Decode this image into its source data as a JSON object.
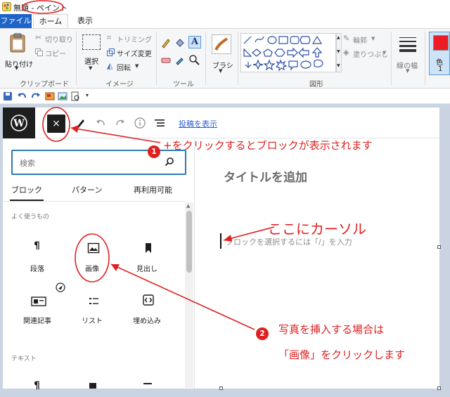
{
  "paint": {
    "title": "無題 - ペイント",
    "tabs": [
      "ファイル",
      "ホーム",
      "表示"
    ],
    "clipboard": {
      "paste": "貼り付け",
      "cut": "切り取り",
      "copy": "コピー",
      "label": "クリップボード"
    },
    "image": {
      "select": "選択",
      "crop": "トリミング",
      "resize": "サイズ変更",
      "rotate": "回転",
      "label": "イメージ"
    },
    "tools": {
      "label": "ツール"
    },
    "brushes": {
      "label": "ブラシ"
    },
    "shapes": {
      "outline": "輪郭",
      "fill": "塗りつぶし",
      "label": "図形"
    },
    "size": {
      "label": "線の幅"
    },
    "color": {
      "label": "色",
      "index": "1",
      "swatch": "#ed1c24"
    }
  },
  "wp": {
    "close_glyph": "×",
    "preview_link": "投稿を表示",
    "search_placeholder": "検索",
    "tabs": [
      "ブロック",
      "パターン",
      "再利用可能"
    ],
    "section_common": "よく使うもの",
    "section_text": "テキスト",
    "blocks": [
      {
        "label": "段落",
        "icon": "paragraph-icon"
      },
      {
        "label": "画像",
        "icon": "image-icon"
      },
      {
        "label": "見出し",
        "icon": "heading-icon"
      },
      {
        "label": "関連記事",
        "icon": "related-posts-icon"
      },
      {
        "label": "リスト",
        "icon": "list-icon"
      },
      {
        "label": "埋め込み",
        "icon": "embed-icon"
      }
    ],
    "editor_title": "タイトルを追加",
    "editor_placeholder": "ブロックを選択するには「/」を入力"
  },
  "annotations": {
    "step1_badge": "1",
    "step1_text": "+をクリックするとブロックが表示されます",
    "cursor_text": "ここにカーソル",
    "step2_badge": "2",
    "step2_text_1": "写真を挿入する場合は",
    "step2_text_2": "「画像」をクリックします",
    "color": "#e02020"
  }
}
